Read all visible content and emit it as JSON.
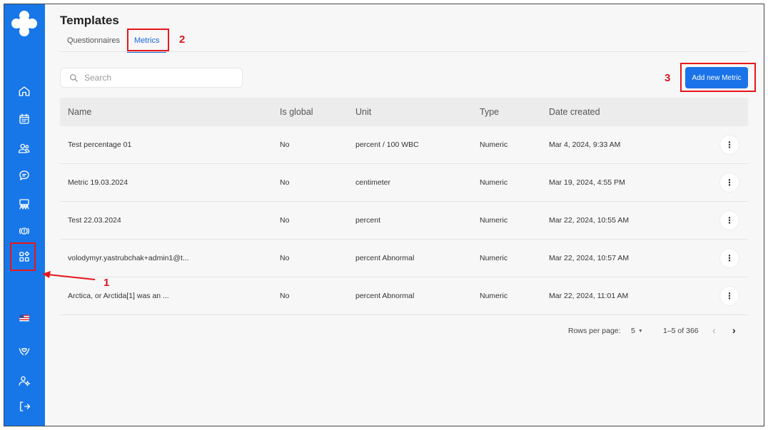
{
  "header": {
    "title": "Templates",
    "tabs": [
      {
        "label": "Questionnaires",
        "active": false
      },
      {
        "label": "Metrics",
        "active": true
      }
    ]
  },
  "search": {
    "placeholder": "Search",
    "value": ""
  },
  "actions": {
    "add_label": "Add new Metric"
  },
  "sidebar": {
    "items": [
      {
        "icon": "home-icon"
      },
      {
        "icon": "calendar-icon"
      },
      {
        "icon": "users-icon"
      },
      {
        "icon": "chat-icon"
      },
      {
        "icon": "group-icon"
      },
      {
        "icon": "alert-icon"
      },
      {
        "icon": "templates-icon"
      },
      {
        "icon": "us-flag-icon"
      },
      {
        "icon": "heart-hands-icon"
      },
      {
        "icon": "user-settings-icon"
      },
      {
        "icon": "logout-icon"
      }
    ]
  },
  "table": {
    "columns": [
      "Name",
      "Is global",
      "Unit",
      "Type",
      "Date created"
    ],
    "rows": [
      {
        "name": "Test percentage 01",
        "is_global": "No",
        "unit": "percent / 100 WBC",
        "type": "Numeric",
        "date": "Mar 4, 2024, 9:33 AM"
      },
      {
        "name": "Metric 19.03.2024",
        "is_global": "No",
        "unit": "centimeter",
        "type": "Numeric",
        "date": "Mar 19, 2024, 4:55 PM"
      },
      {
        "name": "Test 22.03.2024",
        "is_global": "No",
        "unit": "percent",
        "type": "Numeric",
        "date": "Mar 22, 2024, 10:55 AM"
      },
      {
        "name": "volodymyr.yastrubchak+admin1@t...",
        "is_global": "No",
        "unit": "percent Abnormal",
        "type": "Numeric",
        "date": "Mar 22, 2024, 10:57 AM"
      },
      {
        "name": "Arctica, or Arctida[1] was an ...",
        "is_global": "No",
        "unit": "percent Abnormal",
        "type": "Numeric",
        "date": "Mar 22, 2024, 11:01 AM"
      }
    ],
    "more_glyph": "⋮"
  },
  "pagination": {
    "rows_per_page_label": "Rows per page:",
    "rows_per_page": "5",
    "range": "1–5 of 366",
    "prev": "‹",
    "next": "›"
  },
  "annotations": {
    "n1": "1",
    "n2": "2",
    "n3": "3",
    "color": "#e8161b"
  },
  "colors": {
    "sidebar": "#1877e8",
    "accent": "#1a73e8"
  }
}
